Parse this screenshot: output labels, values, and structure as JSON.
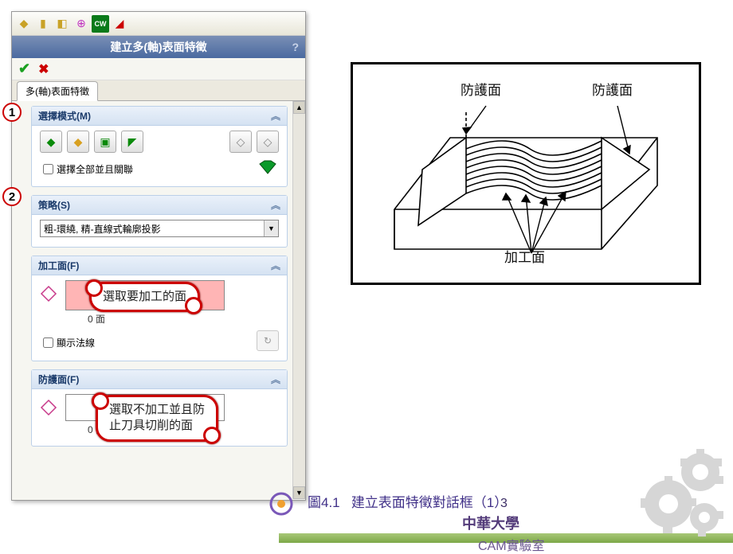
{
  "header": {
    "title": "建立多(軸)表面特徵",
    "help": "?"
  },
  "tab": {
    "label": "多(軸)表面特徵"
  },
  "groups": {
    "selectMode": {
      "title": "選擇模式(M)",
      "checkbox_label": "選擇全部並且關聯"
    },
    "strategy": {
      "title": "策略(S)",
      "combo_value": "粗-環繞, 精-直線式輪廓投影"
    },
    "workFace": {
      "title": "加工面(F)",
      "count": "0 面",
      "show_normals": "顯示法線"
    },
    "guardFace": {
      "title": "防護面(F)",
      "count": "0 面"
    }
  },
  "callouts": {
    "c1": "選取要加工的面",
    "c2_line1": "選取不加工並且防",
    "c2_line2": "止刀具切削的面"
  },
  "badges": {
    "b1": "1",
    "b2": "2"
  },
  "diagram": {
    "label_guard_left": "防護面",
    "label_guard_right": "防護面",
    "label_work": "加工面"
  },
  "caption": {
    "prefix": "圖4.1",
    "text": "建立表面特徵對話框（1）"
  },
  "footer": {
    "university": "中華大學",
    "lab": "CAM實驗室",
    "page": "3",
    "page_inline": "3"
  }
}
